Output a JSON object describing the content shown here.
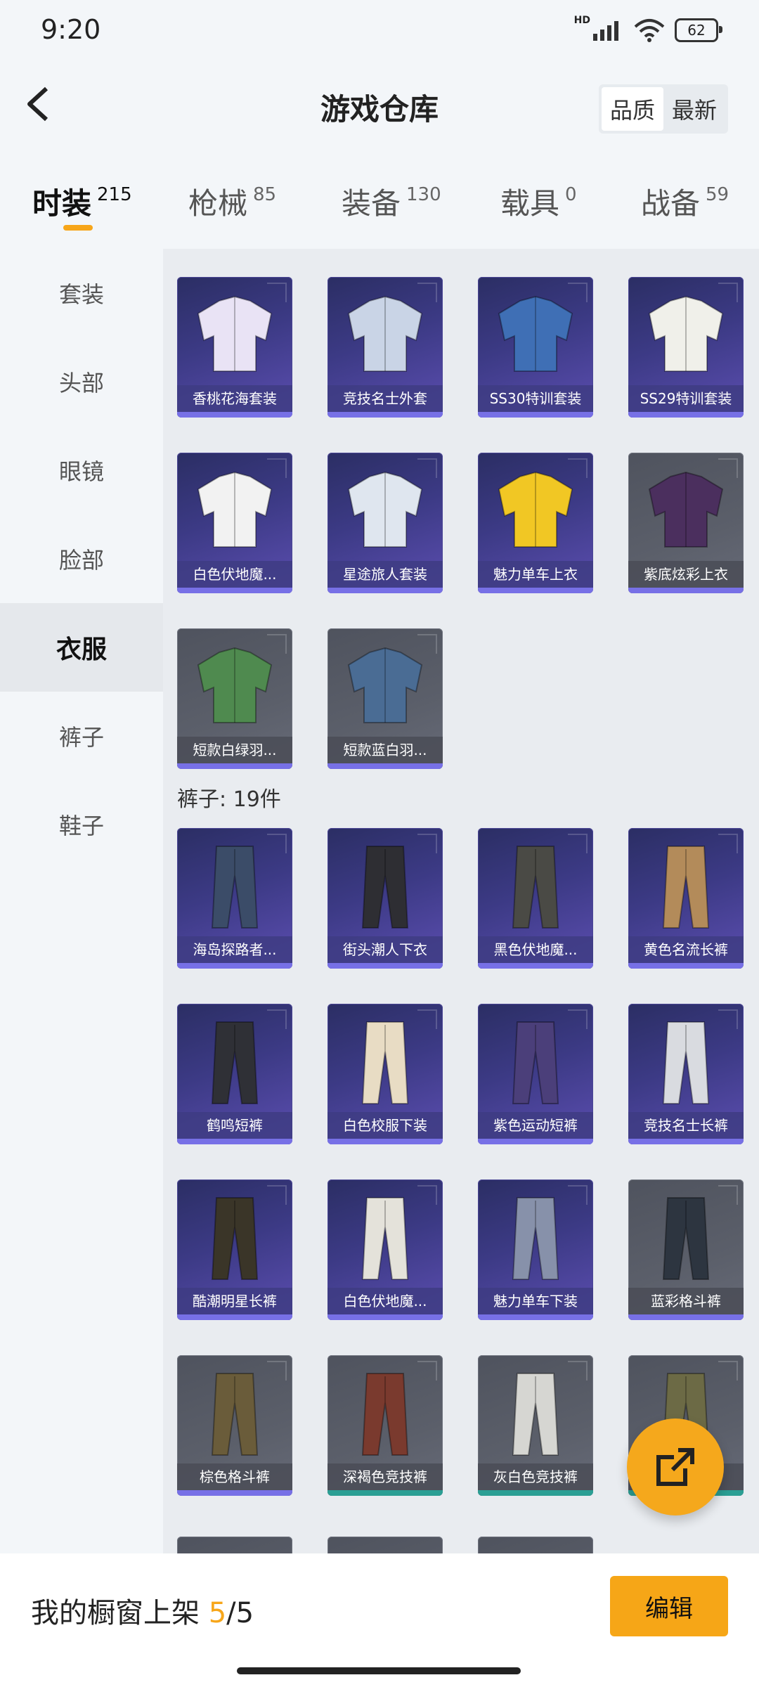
{
  "status_bar": {
    "time": "9:20",
    "network": "HD",
    "battery": "62"
  },
  "header": {
    "title": "游戏仓库",
    "sort_quality": "品质",
    "sort_latest": "最新"
  },
  "tabs": [
    {
      "label": "时装",
      "count": "215"
    },
    {
      "label": "枪械",
      "count": "85"
    },
    {
      "label": "装备",
      "count": "130"
    },
    {
      "label": "载具",
      "count": "0"
    },
    {
      "label": "战备",
      "count": "59"
    }
  ],
  "sidebar": [
    "套装",
    "头部",
    "眼镜",
    "脸部",
    "衣服",
    "裤子",
    "鞋子"
  ],
  "clothes": [
    {
      "name": "香桃花海套装",
      "style": "purple",
      "icon": "pink-outfit-icon"
    },
    {
      "name": "竞技名士外套",
      "style": "purple",
      "icon": "jacket-icon"
    },
    {
      "name": "SS30特训套装",
      "style": "purple",
      "icon": "blue-outfit-icon"
    },
    {
      "name": "SS29特训套装",
      "style": "purple",
      "icon": "white-outfit-icon"
    },
    {
      "name": "白色伏地魔...",
      "style": "purple",
      "icon": "hoodie-icon"
    },
    {
      "name": "星途旅人套装",
      "style": "purple",
      "icon": "space-suit-icon"
    },
    {
      "name": "魅力单车上衣",
      "style": "purple",
      "icon": "yellow-shirt-icon"
    },
    {
      "name": "紫底炫彩上衣",
      "style": "grey",
      "icon": "purple-jacket-icon"
    },
    {
      "name": "短款白绿羽...",
      "style": "grey",
      "icon": "green-down-jacket-icon"
    },
    {
      "name": "短款蓝白羽...",
      "style": "grey",
      "icon": "blue-down-jacket-icon"
    }
  ],
  "pants_section": {
    "title": "裤子: 19件"
  },
  "pants": [
    {
      "name": "海岛探路者...",
      "style": "purple",
      "icon": "denim-shorts-icon",
      "bar": "purple"
    },
    {
      "name": "街头潮人下衣",
      "style": "purple",
      "icon": "street-pants-icon",
      "bar": "purple"
    },
    {
      "name": "黑色伏地魔...",
      "style": "purple",
      "icon": "black-pants-icon",
      "bar": "purple"
    },
    {
      "name": "黄色名流长裤",
      "style": "purple",
      "icon": "khaki-pants-icon",
      "bar": "purple"
    },
    {
      "name": "鹤鸣短裤",
      "style": "purple",
      "icon": "shorts-set-icon",
      "bar": "purple"
    },
    {
      "name": "白色校服下装",
      "style": "purple",
      "icon": "skirt-icon",
      "bar": "purple"
    },
    {
      "name": "紫色运动短裤",
      "style": "purple",
      "icon": "sport-shorts-icon",
      "bar": "purple"
    },
    {
      "name": "竞技名士长裤",
      "style": "purple",
      "icon": "white-pants-icon",
      "bar": "purple"
    },
    {
      "name": "酷潮明星长裤",
      "style": "purple",
      "icon": "star-pants-icon",
      "bar": "purple"
    },
    {
      "name": "白色伏地魔...",
      "style": "purple",
      "icon": "white-camo-pants-icon",
      "bar": "purple"
    },
    {
      "name": "魅力单车下装",
      "style": "purple",
      "icon": "bike-shorts-icon",
      "bar": "purple"
    },
    {
      "name": "蓝彩格斗裤",
      "style": "grey",
      "icon": "combat-pants-icon",
      "bar": "purple"
    },
    {
      "name": "棕色格斗裤",
      "style": "grey",
      "icon": "brown-pants-icon",
      "bar": "purple"
    },
    {
      "name": "深褐色竞技裤",
      "style": "grey",
      "icon": "red-brown-pants-icon",
      "bar": "teal"
    },
    {
      "name": "灰白色竞技裤",
      "style": "grey",
      "icon": "grey-pants-icon",
      "bar": "teal"
    },
    {
      "name": "...裤",
      "style": "grey",
      "icon": "olive-pants-icon",
      "bar": "teal"
    }
  ],
  "bottom_bar": {
    "shelf_label": "我的橱窗上架",
    "shelf_current": "5",
    "shelf_total": "/5",
    "edit_label": "编辑"
  },
  "colors": {
    "accent": "#f7a61a",
    "rare_purple": "#5c4eb1",
    "common_grey": "#5b5f6a",
    "teal_bar": "#2b9f94"
  }
}
